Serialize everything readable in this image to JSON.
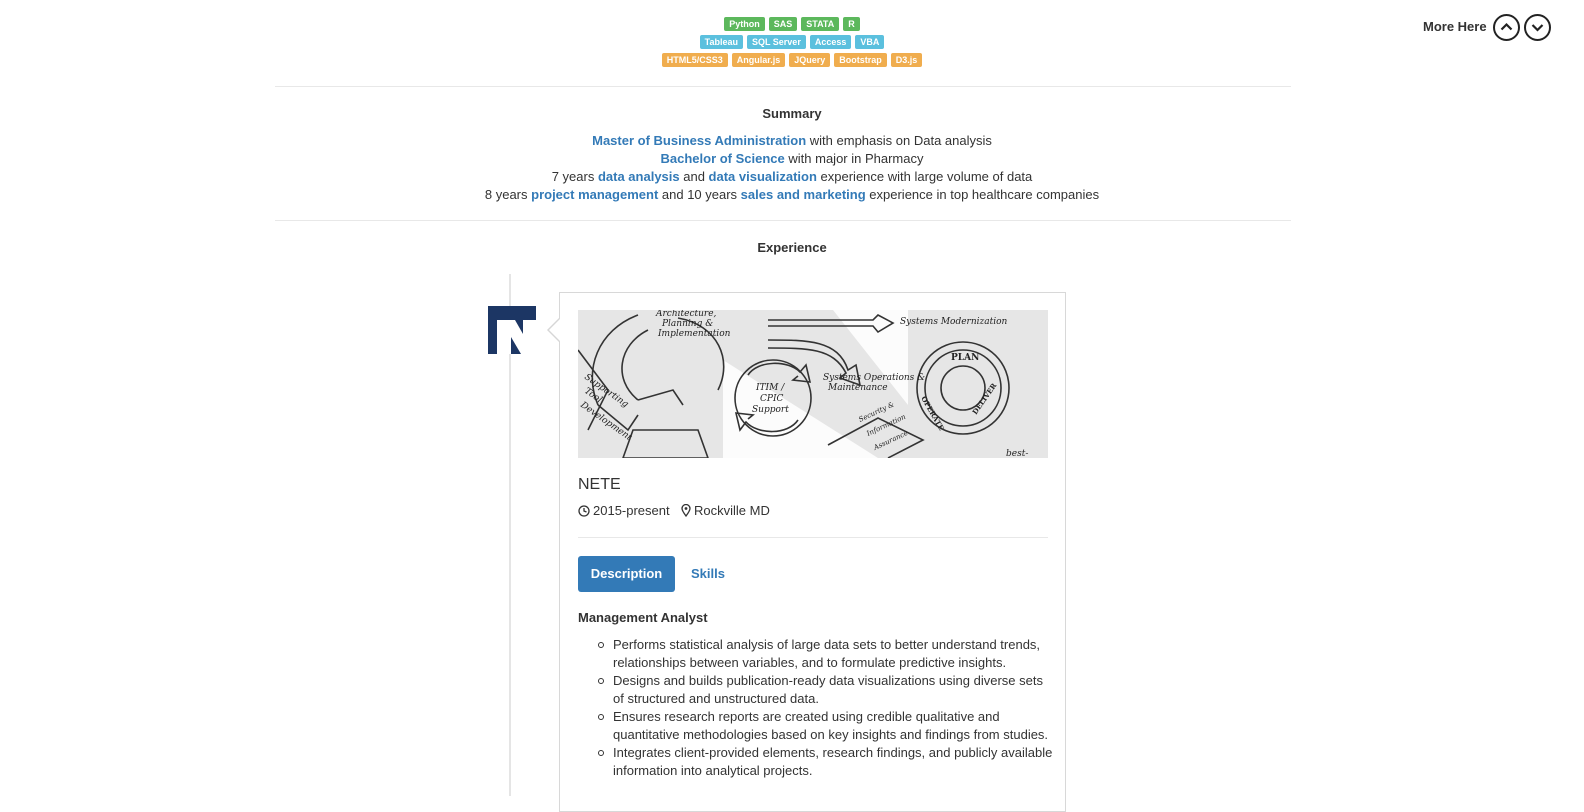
{
  "skills": {
    "row1": [
      "Python",
      "SAS",
      "STATA",
      "R"
    ],
    "row2": [
      "Tableau",
      "SQL Server",
      "Access",
      "VBA"
    ],
    "row3": [
      "HTML5/CSS3",
      "Angular.js",
      "JQuery",
      "Bootstrap",
      "D3.js"
    ],
    "colors": {
      "row1": "#5cb85c",
      "row2": "#5bc0de",
      "row3": "#f0ad4e"
    }
  },
  "nav": {
    "more_label": "More Here",
    "up_icon": "chevron-up-icon",
    "down_icon": "chevron-down-icon"
  },
  "summary": {
    "title": "Summary",
    "line1": {
      "hl1": "Master of Business Administration",
      "t1": " with emphasis on Data analysis"
    },
    "line2": {
      "hl1": "Bachelor of Science",
      "t1": " with major in Pharmacy"
    },
    "line3": {
      "t0": "7 years ",
      "hl1": "data analysis",
      "t1": " and ",
      "hl2": "data visualization",
      "t2": " experience with large volume of data"
    },
    "line4": {
      "t0": "8 years ",
      "hl1": "project management",
      "t1": " and 10 years ",
      "hl2": "sales and marketing",
      "t2": " experience in top healthcare companies"
    }
  },
  "experience": {
    "title": "Experience",
    "job": {
      "company": "NETE",
      "period": "2015-present",
      "location": "Rockville MD",
      "tabs": {
        "description": "Description",
        "skills": "Skills"
      },
      "role": "Management Analyst",
      "duties": [
        "Performs statistical analysis of large data sets to better understand trends, relationships between variables, and to formulate predictive insights.",
        "Designs and builds publication-ready data visualizations using diverse sets of structured and unstructured data.",
        "Ensures research reports are created using credible qualitative and quantitative methodologies based on key insights and findings from studies.",
        "Integrates client-provided elements, research findings, and publicly available information into analytical projects."
      ],
      "image_texts": {
        "t1": "Architecture,",
        "t2": "Planning &",
        "t3": "Implementation",
        "t4": "Systems Modernization",
        "t5": "Supporting",
        "t6": "Tool",
        "t7": "Development",
        "t8": "ITIM /",
        "t9": "CPIC",
        "t10": "Support",
        "t11": "Systems Operations &",
        "t12": "Maintenance",
        "t13": "PLAN",
        "t14": "OPERATE",
        "t15": "DELIVER",
        "t16": "Security &",
        "t17": "Information",
        "t18": "Assurance",
        "t19": "best-"
      }
    }
  }
}
